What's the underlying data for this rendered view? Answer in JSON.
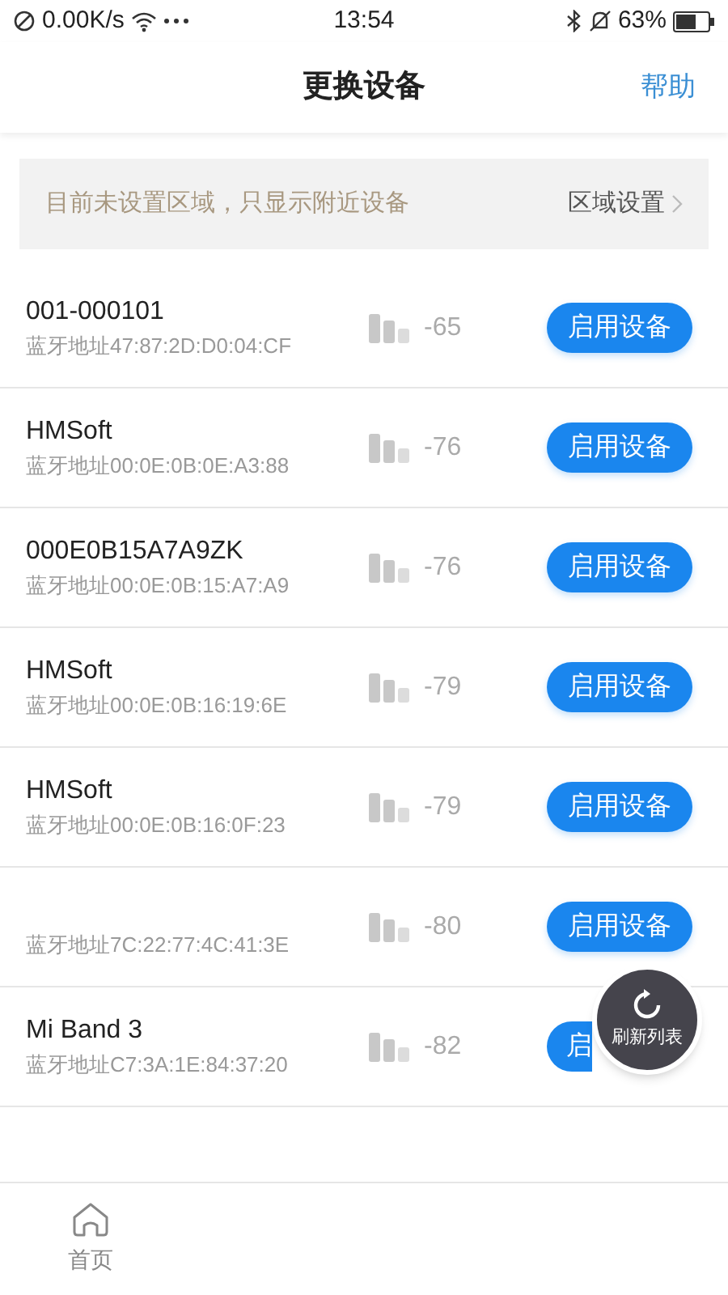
{
  "status_bar": {
    "speed": "0.00K/s",
    "time": "13:54",
    "battery": "63%"
  },
  "header": {
    "title": "更换设备",
    "help": "帮助"
  },
  "notice": {
    "text": "目前未设置区域，只显示附近设备",
    "action": "区域设置"
  },
  "devices": [
    {
      "kind": "full",
      "name": "001-000101",
      "address": "蓝牙地址47:87:2D:D0:04:CF",
      "rssi": "-65",
      "button": "启用设备"
    },
    {
      "kind": "full",
      "name": "HMSoft",
      "address": "蓝牙地址00:0E:0B:0E:A3:88",
      "rssi": "-76",
      "button": "启用设备"
    },
    {
      "kind": "full",
      "name": "000E0B15A7A9ZK",
      "address": "蓝牙地址00:0E:0B:15:A7:A9",
      "rssi": "-76",
      "button": "启用设备"
    },
    {
      "kind": "full",
      "name": "HMSoft",
      "address": "蓝牙地址00:0E:0B:16:19:6E",
      "rssi": "-79",
      "button": "启用设备"
    },
    {
      "kind": "full",
      "name": "HMSoft",
      "address": "蓝牙地址00:0E:0B:16:0F:23",
      "rssi": "-79",
      "button": "启用设备"
    },
    {
      "kind": "full",
      "address": "蓝牙地址7C:22:77:4C:41:3E",
      "rssi": "-80",
      "button": "启用设备"
    },
    {
      "kind": "covered",
      "name": "Mi Band 3",
      "address": "蓝牙地址C7:3A:1E:84:37:20",
      "rssi": "-82",
      "button": "启"
    }
  ],
  "refresh_button": {
    "label": "刷新列表"
  },
  "tab_bar": [
    {
      "label": "首页"
    }
  ]
}
